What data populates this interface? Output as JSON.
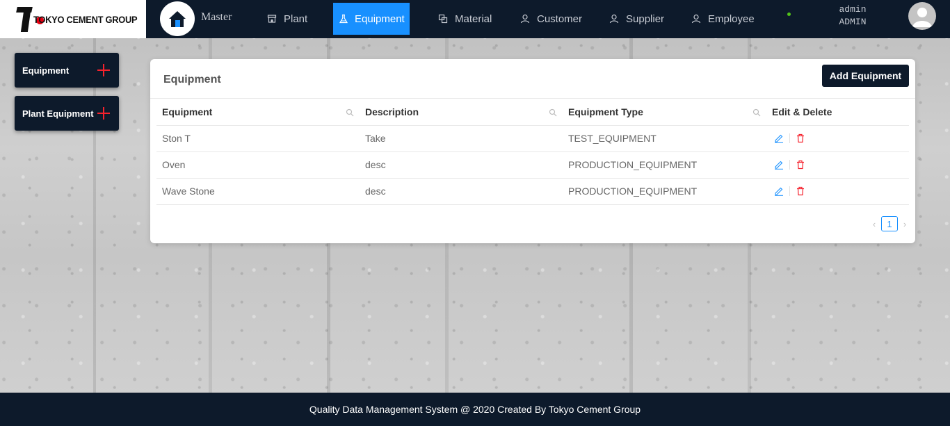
{
  "brand": {
    "name": "TOKYO CEMENT GROUP"
  },
  "header": {
    "master_label": "Master",
    "nav": [
      {
        "label": "Plant",
        "icon": "shop-icon"
      },
      {
        "label": "Equipment",
        "icon": "beaker-icon",
        "active": true
      },
      {
        "label": "Material",
        "icon": "block-icon"
      },
      {
        "label": "Customer",
        "icon": "user-icon"
      },
      {
        "label": "Supplier",
        "icon": "user-icon"
      },
      {
        "label": "Employee",
        "icon": "user-icon"
      }
    ],
    "user": {
      "name": "admin",
      "role": "ADMIN"
    }
  },
  "sidebar": {
    "items": [
      {
        "label": "Equipment",
        "icon": "plus-icon"
      },
      {
        "label": "Plant Equipment",
        "icon": "plus-icon"
      }
    ]
  },
  "card": {
    "title": "Equipment",
    "add_button": "Add Equipment",
    "columns": [
      "Equipment",
      "Description",
      "Equipment Type",
      "Edit & Delete"
    ],
    "rows": [
      {
        "equipment": "Ston T",
        "description": "Take",
        "type": "TEST_EQUIPMENT"
      },
      {
        "equipment": "Oven",
        "description": "desc",
        "type": "PRODUCTION_EQUIPMENT"
      },
      {
        "equipment": "Wave Stone",
        "description": "desc",
        "type": "PRODUCTION_EQUIPMENT"
      }
    ],
    "pagination": {
      "current": "1"
    }
  },
  "footer": {
    "text": "Quality Data Management System @ 2020 Created By Tokyo Cement Group"
  },
  "colors": {
    "navy": "#0d1a2b",
    "accent": "#1890ff",
    "danger": "#f5222d",
    "status": "#52c41a"
  }
}
